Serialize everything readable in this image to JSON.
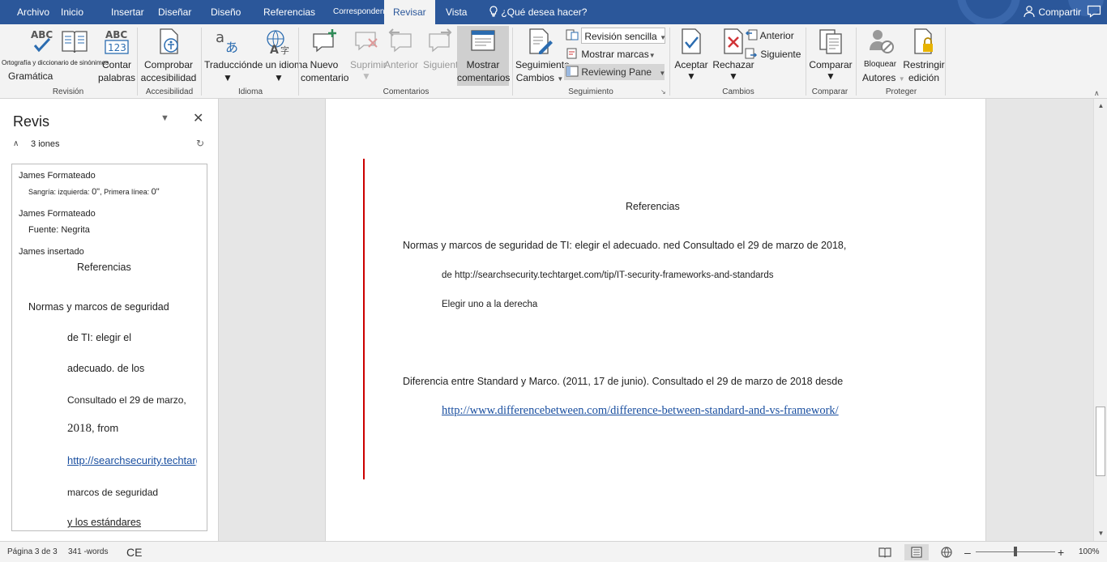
{
  "menu": {
    "tabs": [
      "Archivo",
      "Inicio",
      "Insertar",
      "Diseñar",
      "Diseño",
      "Referencias",
      "Correspondencia",
      "Revisar",
      "Vista"
    ],
    "tell_me": "¿Qué desea hacer?",
    "share": "Compartir"
  },
  "ribbon": {
    "groups": {
      "revision": "Revisión",
      "accesibilidad": "Accesibilidad",
      "idioma": "Idioma",
      "comentarios": "Comentarios",
      "seguimiento": "Seguimiento",
      "cambios": "Cambios",
      "comparar": "Comparar",
      "proteger": "Proteger"
    },
    "buttons": {
      "spelling_line1": "Ortografía y diccionario de sinónimos",
      "spelling_line2": "Gramática",
      "word_count_line1": "Contar",
      "word_count_line2": "palabras",
      "accessibility_line1": "Comprobar",
      "accessibility_line2": "accesibilidad",
      "translate": "Traducción",
      "language": "de un idioma",
      "new_comment_line1": "Nuevo",
      "new_comment_line2": "comentario",
      "delete": "Suprimir",
      "previous_comment": "Anterior",
      "next_comment": "Siguiente",
      "show_comments_line1": "Mostrar",
      "show_comments_line2": "comentarios",
      "track_changes_line1": "Seguimiento",
      "track_changes_line2": "Cambios",
      "display_for_review": "Revisión sencilla",
      "show_markup": "Mostrar marcas",
      "reviewing_pane": "Reviewing Pane",
      "accept": "Aceptar",
      "reject": "Rechazar",
      "previous_change": "Anterior",
      "next_change": "Siguiente",
      "compare": "Comparar",
      "block_authors_line1": "Bloquear",
      "block_authors_line2": "Autores",
      "restrict_line1": "Restringir",
      "restrict_line2": "edición"
    }
  },
  "pane": {
    "title": "Revis",
    "count": "3",
    "count_label": "iones",
    "revisions": [
      {
        "author": "James Formateado",
        "detail_a": "Sangría: izquierda:",
        "value_a": "0\"",
        "detail_b": ", Primera línea:",
        "value_b": "0\""
      },
      {
        "author": "James Formateado",
        "detail": "Fuente: Negrita"
      },
      {
        "author": "James insertado",
        "title": "Referencias",
        "lines": [
          "Normas y marcos de seguridad",
          "de TI: elegir el",
          "adecuado. de los",
          "Consultado el 29 de marzo,"
        ],
        "line5_year": "2018",
        "line5_rest": ", from",
        "line6_link": "http://searchsecurity.techtarget.com",
        "line7": "marcos de seguridad",
        "line8": "y los estándares"
      }
    ]
  },
  "document": {
    "heading": "Referencias",
    "ref1_line1": "Normas y marcos de seguridad de TI: elegir el adecuado. ned Consultado el 29 de marzo de 2018,",
    "ref1_line2": "de http://searchsecurity.techtarget.com/tip/IT-security-frameworks-and-standards",
    "ref1_line3": "Elegir uno a la derecha",
    "ref2_line1": "Diferencia entre Standard y Marco. (2011, 17 de junio). Consultado el 29 de marzo de 2018 desde",
    "ref2_link": "http://www.differencebetween.com/difference-between-standard-and-vs-framework/"
  },
  "status": {
    "page": "Página 3 de 3",
    "words": "341 -words",
    "lang": "CE",
    "zoom_label": "100%",
    "zoom_percent": 100
  }
}
